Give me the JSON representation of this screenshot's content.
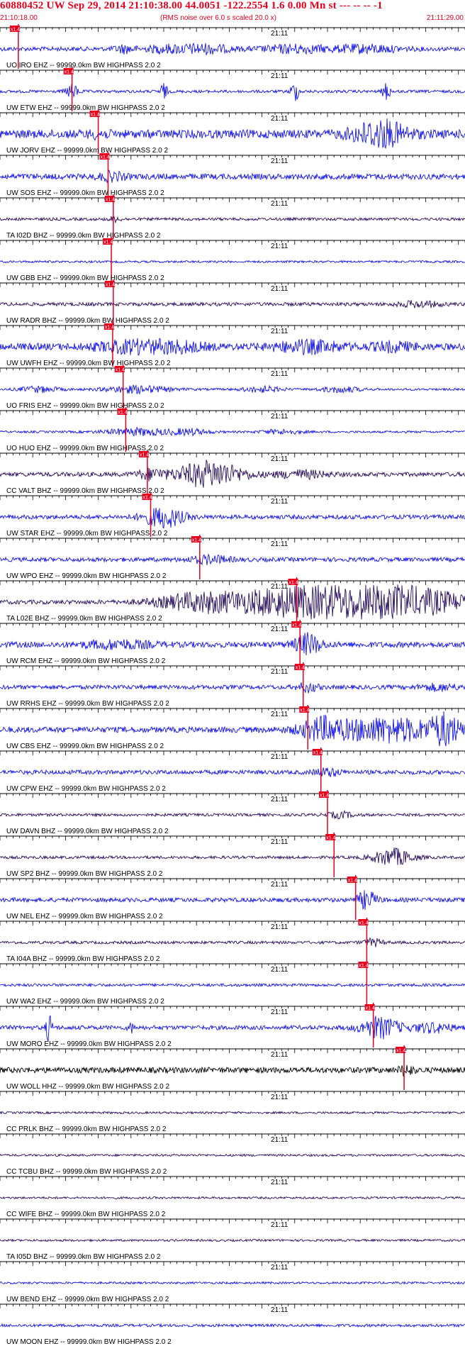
{
  "header": {
    "title": "60880452 UW Sep 29, 2014 21:10:38.00   44.0051 -122.2554  1.6 0.00 Mn st --- -- --   -1",
    "start_time": "21:10:18.00",
    "rms_note": "(RMS noise over 6.0 s scaled 20.0 x)",
    "end_time": "21:11:29.00"
  },
  "colors": {
    "header_text": "#e8001c",
    "trace_blue": "#1414e6",
    "trace_dark": "#2a1060",
    "trace_black": "#000000",
    "pick_marker": "#e8001c",
    "marker_label": "#ffffff",
    "grid_line": "#000000"
  },
  "chart_data": {
    "type": "line",
    "description_units": "seconds after 21:10:18.00",
    "x_range": [
      0,
      71
    ],
    "minute_mark": {
      "label": "21:11",
      "time": 42
    },
    "series": [
      {
        "name": "UO IRO EHZ -- 99999.0km BW  HIGHPASS  2.0  2",
        "pick_label": "x1.4",
        "pick_time": 2.8,
        "amp": 3,
        "color": "blue",
        "bursts": [
          [
            19,
            1.5,
            5
          ],
          [
            25,
            3,
            4
          ],
          [
            31,
            4,
            6
          ],
          [
            45,
            5,
            5
          ],
          [
            56,
            5,
            5
          ]
        ]
      },
      {
        "name": "UW ETW EHZ -- 99999.0km BW  HIGHPASS  2.0  2",
        "pick_label": "x1.4",
        "pick_time": 11.0,
        "amp": 2,
        "color": "blue",
        "bursts": [
          [
            11,
            1,
            9
          ],
          [
            25,
            0.5,
            12
          ],
          [
            45,
            0.6,
            14
          ],
          [
            59,
            0.6,
            12
          ]
        ]
      },
      {
        "name": "UW JORV EHZ -- 99999.0km BW  HIGHPASS  2.0  2",
        "pick_label": "x1.4",
        "pick_time": 15.0,
        "amp": 6,
        "color": "blue",
        "bursts": [
          [
            15,
            1.5,
            3
          ],
          [
            58,
            4,
            18
          ]
        ]
      },
      {
        "name": "UW SOS EHZ -- 99999.0km BW  HIGHPASS  2.0  2",
        "pick_label": "x1.4",
        "pick_time": 16.5,
        "amp": 4,
        "color": "blue",
        "bursts": [
          [
            17,
            2,
            5
          ]
        ]
      },
      {
        "name": "TA I02D BHZ -- 99999.0km BW  HIGHPASS  2.0  2",
        "pick_label": "x1.4",
        "pick_time": 17.3,
        "amp": 2,
        "color": "dark",
        "bursts": [
          [
            17.5,
            1,
            3
          ]
        ]
      },
      {
        "name": "UW GBB EHZ -- 99999.0km BW  HIGHPASS  2.0  2",
        "pick_label": "x1.4",
        "pick_time": 17.0,
        "amp": 1.5,
        "color": "blue",
        "bursts": []
      },
      {
        "name": "UW RADR BHZ -- 99999.0km BW  HIGHPASS  2.0  2",
        "pick_label": "x1.4",
        "pick_time": 17.3,
        "amp": 2.5,
        "color": "dark",
        "bursts": [
          [
            64,
            3,
            4
          ]
        ]
      },
      {
        "name": "UW UWFH EHZ -- 99999.0km BW  HIGHPASS  2.0  2",
        "pick_label": "x1.4",
        "pick_time": 17.2,
        "amp": 5,
        "color": "blue",
        "bursts": [
          [
            20,
            5,
            7
          ],
          [
            27,
            4,
            6
          ],
          [
            47,
            5,
            7
          ],
          [
            60,
            3,
            5
          ]
        ]
      },
      {
        "name": "UO FRIS EHZ -- 99999.0km BW  HIGHPASS  2.0  2",
        "pick_label": "x1.4",
        "pick_time": 18.8,
        "amp": 1.5,
        "color": "blue",
        "bursts": [
          [
            6,
            3,
            4
          ],
          [
            21,
            5,
            5
          ],
          [
            40,
            3,
            4
          ],
          [
            52,
            3,
            4
          ]
        ]
      },
      {
        "name": "UO HUO EHZ -- 99999.0km BW  HIGHPASS  2.0  2",
        "pick_label": "x1.4",
        "pick_time": 19.2,
        "amp": 1.5,
        "color": "blue",
        "bursts": [
          [
            21,
            5,
            5
          ],
          [
            29,
            3,
            4
          ],
          [
            43,
            3,
            3
          ]
        ]
      },
      {
        "name": "CC VALT BHZ -- 99999.0km BW  HIGHPASS  2.0  2",
        "pick_label": "x1.4",
        "pick_time": 22.5,
        "amp": 3,
        "color": "dark",
        "bursts": [
          [
            23,
            2,
            7
          ],
          [
            32,
            5,
            18
          ],
          [
            46,
            4,
            5
          ]
        ]
      },
      {
        "name": "UW STAR EHZ -- 99999.0km BW  HIGHPASS  2.0  2",
        "pick_label": "x1.4",
        "pick_time": 23.0,
        "amp": 3,
        "color": "blue",
        "bursts": [
          [
            25,
            3,
            14
          ]
        ]
      },
      {
        "name": "UW WPO EHZ -- 99999.0km BW  HIGHPASS  2.0  2",
        "pick_label": "x1.4",
        "pick_time": 30.5,
        "amp": 3,
        "color": "blue",
        "bursts": [
          [
            32,
            3,
            5
          ]
        ]
      },
      {
        "name": "TA L02E BHZ -- 99999.0km BW  HIGHPASS  2.0  2",
        "pick_label": "x1.4",
        "pick_time": 45.3,
        "amp": 3,
        "color": "dark",
        "bursts": [
          [
            30,
            6,
            10
          ],
          [
            46,
            12,
            20
          ],
          [
            62,
            10,
            18
          ]
        ]
      },
      {
        "name": "UW RCM EHZ -- 99999.0km BW  HIGHPASS  2.0  2",
        "pick_label": "x1.4",
        "pick_time": 45.8,
        "amp": 4,
        "color": "blue",
        "bursts": [
          [
            18,
            5,
            5
          ],
          [
            47,
            2,
            14
          ]
        ]
      },
      {
        "name": "UW RRHS EHZ -- 99999.0km BW  HIGHPASS  2.0  2",
        "pick_label": "x1.4",
        "pick_time": 46.3,
        "amp": 3,
        "color": "blue",
        "bursts": [
          [
            47,
            1.5,
            6
          ],
          [
            67,
            3,
            4
          ]
        ]
      },
      {
        "name": "UW CBS EHZ -- 99999.0km BW  HIGHPASS  2.0  2",
        "pick_label": "x1.4",
        "pick_time": 47.0,
        "amp": 4,
        "color": "blue",
        "bursts": [
          [
            49,
            3,
            12
          ],
          [
            59,
            9,
            16
          ],
          [
            68,
            2,
            18
          ]
        ]
      },
      {
        "name": "UW CPW EHZ -- 99999.0km BW  HIGHPASS  2.0  2",
        "pick_label": "x1.4",
        "pick_time": 49.0,
        "amp": 3,
        "color": "blue",
        "bursts": [
          [
            50,
            2,
            5
          ]
        ]
      },
      {
        "name": "UW DAVN BHZ -- 99999.0km BW  HIGHPASS  2.0  2",
        "pick_label": "x1.4",
        "pick_time": 50.0,
        "amp": 2,
        "color": "dark",
        "bursts": [
          [
            52,
            2,
            4
          ]
        ]
      },
      {
        "name": "UW SP2 BHZ -- 99999.0km BW  HIGHPASS  2.0  2",
        "pick_label": "x1.4",
        "pick_time": 51.0,
        "amp": 2,
        "color": "dark",
        "bursts": [
          [
            60,
            3,
            12
          ]
        ]
      },
      {
        "name": "UW NEL EHZ -- 99999.0km BW  HIGHPASS  2.0  2",
        "pick_label": "x1.4",
        "pick_time": 54.3,
        "amp": 3,
        "color": "blue",
        "bursts": [
          [
            56,
            1.5,
            12
          ]
        ]
      },
      {
        "name": "TA I04A BHZ -- 99999.0km BW  HIGHPASS  2.0  2",
        "pick_label": "x1.4",
        "pick_time": 56.0,
        "amp": 2,
        "color": "dark",
        "bursts": [
          [
            57,
            1.5,
            5
          ]
        ]
      },
      {
        "name": "UW WA2 EHZ -- 99999.0km BW  HIGHPASS  2.0  2",
        "pick_label": "x1.4",
        "pick_time": 56.0,
        "amp": 2,
        "color": "blue",
        "bursts": []
      },
      {
        "name": "UW MORO EHZ -- 99999.0km BW  HIGHPASS  2.0  2",
        "pick_label": "x1.4",
        "pick_time": 57.0,
        "amp": 3,
        "color": "blue",
        "bursts": [
          [
            7.5,
            0.5,
            18
          ],
          [
            20,
            0.5,
            6
          ],
          [
            58,
            3,
            14
          ],
          [
            66,
            3,
            6
          ]
        ]
      },
      {
        "name": "UW WOLL HHZ -- 99999.0km BW  HIGHPASS  2.0  2",
        "pick_label": "x1.4",
        "pick_time": 61.7,
        "amp": 4,
        "color": "black",
        "bursts": [
          [
            62,
            1,
            7
          ]
        ]
      },
      {
        "name": "CC PRLK BHZ -- 99999.0km BW  HIGHPASS  2.0  2",
        "pick_label": "",
        "pick_time": null,
        "amp": 1.5,
        "color": "dark",
        "bursts": []
      },
      {
        "name": "CC TCBU BHZ -- 99999.0km BW  HIGHPASS  2.0  2",
        "pick_label": "",
        "pick_time": null,
        "amp": 1.5,
        "color": "dark",
        "bursts": []
      },
      {
        "name": "CC WIFE BHZ -- 99999.0km BW  HIGHPASS  2.0  2",
        "pick_label": "",
        "pick_time": null,
        "amp": 1.5,
        "color": "dark",
        "bursts": []
      },
      {
        "name": "TA I05D BHZ -- 99999.0km BW  HIGHPASS  2.0  2",
        "pick_label": "",
        "pick_time": null,
        "amp": 1.5,
        "color": "dark",
        "bursts": []
      },
      {
        "name": "UW BEND EHZ -- 99999.0km BW  HIGHPASS  2.0  2",
        "pick_label": "",
        "pick_time": null,
        "amp": 1.5,
        "color": "blue",
        "bursts": []
      },
      {
        "name": "UW MOON EHZ -- 99999.0km BW  HIGHPASS  2.0  2",
        "pick_label": "",
        "pick_time": null,
        "amp": 2,
        "color": "blue",
        "bursts": []
      }
    ]
  }
}
